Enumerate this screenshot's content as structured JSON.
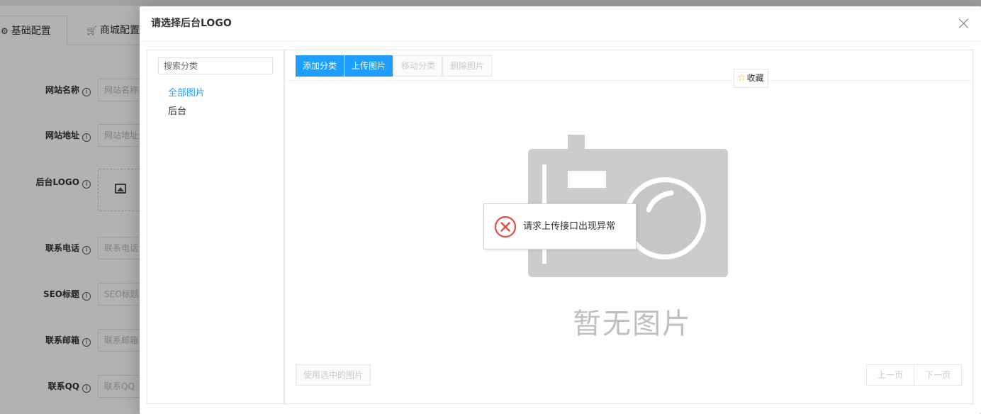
{
  "background": {
    "tabs": [
      {
        "label": "基础配置",
        "icon": "gear-icon"
      },
      {
        "label": "商城配置",
        "icon": "cart-icon"
      }
    ],
    "fields": [
      {
        "label": "网站名称",
        "placeholder": "网站名称"
      },
      {
        "label": "网站地址",
        "placeholder": "网站地址"
      },
      {
        "label": "后台LOGO"
      },
      {
        "label": "联系电话",
        "placeholder": "联系电话"
      },
      {
        "label": "SEO标题",
        "placeholder": "SEO标题"
      },
      {
        "label": "联系邮箱",
        "placeholder": "联系邮箱"
      },
      {
        "label": "联系QQ",
        "placeholder": "联系QQ"
      }
    ],
    "info_glyph": "i"
  },
  "modal": {
    "title": "请选择后台LOGO",
    "search": {
      "placeholder": "搜索分类"
    },
    "categories": [
      {
        "label": "全部图片",
        "active": true
      },
      {
        "label": "后台",
        "active": false
      }
    ],
    "toolbar": {
      "add_category": "添加分类",
      "upload_image": "上传图片",
      "move_category": "移动分类",
      "delete_image": "删除图片"
    },
    "favorite": {
      "label": "收藏",
      "icon": "star-icon"
    },
    "empty_text": "暂无图片",
    "toast": {
      "message": "请求上传接口出现异常",
      "icon": "error-circle-icon"
    },
    "use_selected": "使用选中的图片",
    "pagination": {
      "prev": "上一页",
      "next": "下一页"
    }
  },
  "colors": {
    "primary": "#1e9fff",
    "active_category": "#1e9fff",
    "toast_error": "#e84c3d",
    "placeholder_art": "#cccccc",
    "overlay": "rgba(0,0,0,0.3)"
  }
}
